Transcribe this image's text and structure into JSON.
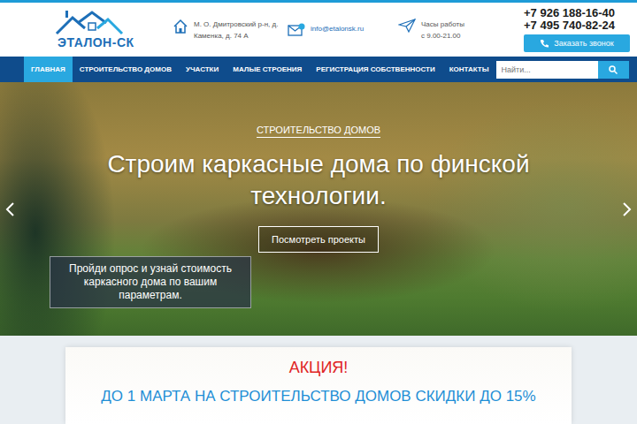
{
  "logo": {
    "text": "ЭТАЛОН-СК"
  },
  "contacts": {
    "address": [
      "М. О. Дмитровский р-н, д.",
      "Каменка, д. 74 А"
    ],
    "email": "info@etalonsk.ru",
    "hours": [
      "Часы работы",
      "с 9.00-21.00"
    ]
  },
  "phones": [
    "+7 926 188-16-40",
    "+7 495 740-82-24"
  ],
  "callback_button": "Заказать звонок",
  "nav": [
    {
      "label": "ГЛАВНАЯ",
      "selected": true
    },
    {
      "label": "СТРОИТЕЛЬСТВО ДОМОВ",
      "selected": false
    },
    {
      "label": "УЧАСТКИ",
      "selected": false
    },
    {
      "label": "МАЛЫЕ СТРОЕНИЯ",
      "selected": false
    },
    {
      "label": "РЕГИСТРАЦИЯ СОБСТВЕННОСТИ",
      "selected": false
    },
    {
      "label": "КОНТАКТЫ",
      "selected": false
    }
  ],
  "search": {
    "placeholder": "Найти..."
  },
  "hero": {
    "category": "СТРОИТЕЛЬСТВО ДОМОВ",
    "title": "Строим каркасные дома по финской технологии.",
    "button": "Посмотреть проекты",
    "quiz": "Пройди опрос и узнай стоимость каркасного дома по вашим параметрам."
  },
  "promo": {
    "label": "АКЦИЯ!",
    "text": "ДО 1 МАРТА НА СТРОИТЕЛЬСТВО ДОМОВ СКИДКИ ДО 15%"
  }
}
